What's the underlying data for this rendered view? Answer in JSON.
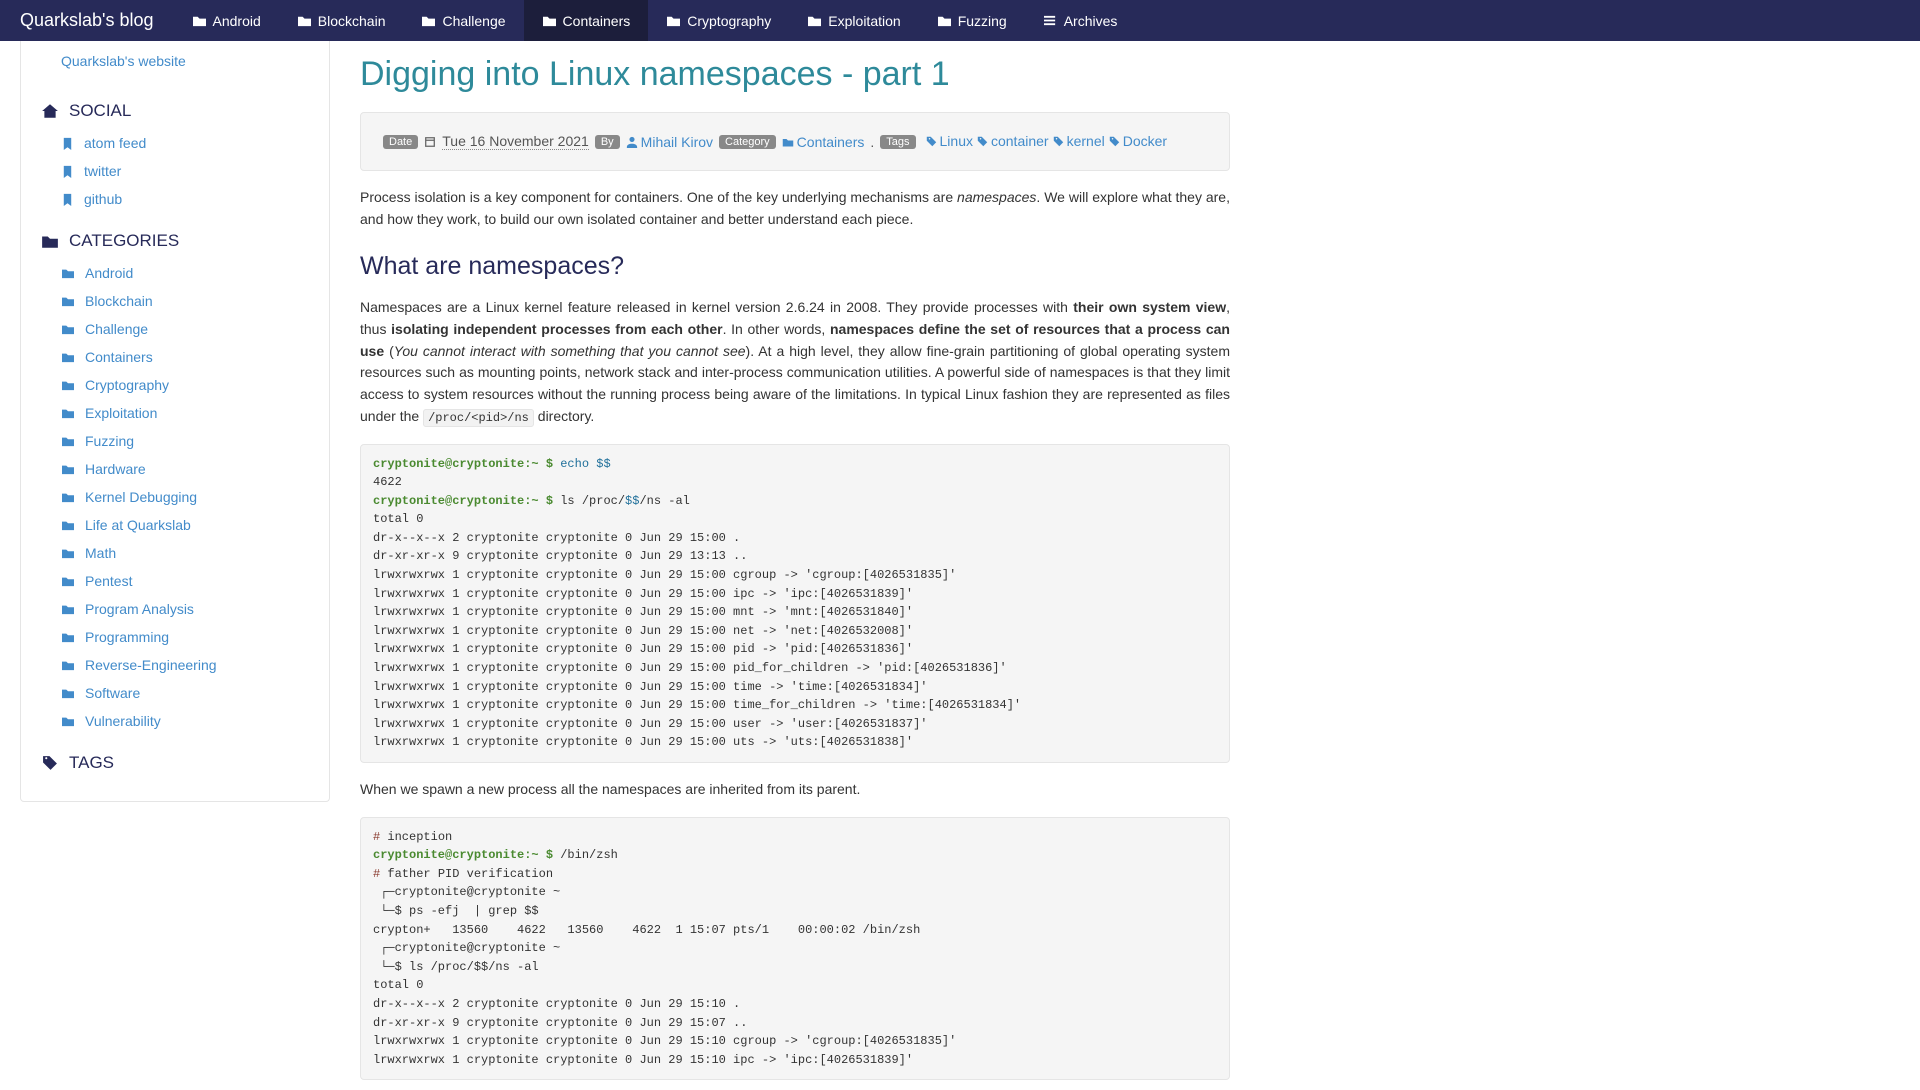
{
  "brand": "Quarkslab's blog",
  "nav": [
    {
      "label": "Android",
      "icon": "folder"
    },
    {
      "label": "Blockchain",
      "icon": "folder"
    },
    {
      "label": "Challenge",
      "icon": "folder"
    },
    {
      "label": "Containers",
      "icon": "folder",
      "active": true
    },
    {
      "label": "Cryptography",
      "icon": "folder"
    },
    {
      "label": "Exploitation",
      "icon": "folder"
    },
    {
      "label": "Fuzzing",
      "icon": "folder"
    },
    {
      "label": "Archives",
      "icon": "list"
    }
  ],
  "sidebar": {
    "site_link": "Quarkslab's website",
    "social_h": "SOCIAL",
    "social": [
      {
        "label": "atom feed",
        "icon": "bookmark"
      },
      {
        "label": "twitter",
        "icon": "bookmark"
      },
      {
        "label": "github",
        "icon": "bookmark"
      }
    ],
    "categories_h": "CATEGORIES",
    "categories": [
      "Android",
      "Blockchain",
      "Challenge",
      "Containers",
      "Cryptography",
      "Exploitation",
      "Fuzzing",
      "Hardware",
      "Kernel Debugging",
      "Life at Quarkslab",
      "Math",
      "Pentest",
      "Program Analysis",
      "Programming",
      "Reverse-Engineering",
      "Software",
      "Vulnerability"
    ],
    "tags_h": "TAGS"
  },
  "article": {
    "title": "Digging into Linux namespaces - part 1",
    "meta": {
      "date_label": "Date",
      "date": "Tue 16 November 2021",
      "by_label": "By",
      "author": "Mihail Kirov",
      "category_label": "Category",
      "category": "Containers",
      "dot": ".",
      "tags_label": "Tags",
      "tags": [
        "Linux",
        "container",
        "kernel",
        "Docker"
      ]
    },
    "p1_a": "Process isolation is a key component for containers. One of the key underlying mechanisms are ",
    "p1_em": "namespaces",
    "p1_b": ". We will explore what they are, and how they work, to build our own isolated container and better understand each piece.",
    "h_what": "What are namespaces?",
    "p2_a": "Namespaces are a Linux kernel feature released in kernel version 2.6.24 in 2008. They provide processes with ",
    "p2_s1": "their own system view",
    "p2_b": ", thus ",
    "p2_s2": "isolating independent processes from each other",
    "p2_c": ". In other words, ",
    "p2_s3": "namespaces define the set of resources that a process can use",
    "p2_d": " (",
    "p2_em": "You cannot interact with something that you cannot see",
    "p2_e": "). At a high level, they allow fine-grain partitioning of global operating system resources such as mounting points, network stack and inter-process communication utilities. A powerful side of namespaces is that they limit access to system resources without the running process being aware of the limitations. In typical Linux fashion they are represented as files under the ",
    "p2_code": "/proc/<pid>/ns",
    "p2_f": " directory.",
    "code1": {
      "prompt": "cryptonite@cryptonite:~ $",
      "echo": "echo",
      "dd": "$$",
      "pid": "4622",
      "ls": "ls /proc/",
      "ls_tail": "/ns -al",
      "body": "total 0\ndr-x--x--x 2 cryptonite cryptonite 0 Jun 29 15:00 .\ndr-xr-xr-x 9 cryptonite cryptonite 0 Jun 29 13:13 ..\nlrwxrwxrwx 1 cryptonite cryptonite 0 Jun 29 15:00 cgroup -> 'cgroup:[4026531835]'\nlrwxrwxrwx 1 cryptonite cryptonite 0 Jun 29 15:00 ipc -> 'ipc:[4026531839]'\nlrwxrwxrwx 1 cryptonite cryptonite 0 Jun 29 15:00 mnt -> 'mnt:[4026531840]'\nlrwxrwxrwx 1 cryptonite cryptonite 0 Jun 29 15:00 net -> 'net:[4026532008]'\nlrwxrwxrwx 1 cryptonite cryptonite 0 Jun 29 15:00 pid -> 'pid:[4026531836]'\nlrwxrwxrwx 1 cryptonite cryptonite 0 Jun 29 15:00 pid_for_children -> 'pid:[4026531836]'\nlrwxrwxrwx 1 cryptonite cryptonite 0 Jun 29 15:00 time -> 'time:[4026531834]'\nlrwxrwxrwx 1 cryptonite cryptonite 0 Jun 29 15:00 time_for_children -> 'time:[4026531834]'\nlrwxrwxrwx 1 cryptonite cryptonite 0 Jun 29 15:00 user -> 'user:[4026531837]'\nlrwxrwxrwx 1 cryptonite cryptonite 0 Jun 29 15:00 uts -> 'uts:[4026531838]'"
    },
    "p3": "When we spawn a new process all the namespaces are inherited from its parent.",
    "code2": {
      "c1": "# ",
      "c1t": "inception",
      "prompt": "cryptonite@cryptonite:~ $",
      "cmd1": "/bin/zsh",
      "c2": "# ",
      "c2t": "father PID verification",
      "body": " ┌─cryptonite@cryptonite ~\n └─$ ps -efj  | grep $$\ncrypton+   13560    4622   13560    4622  1 15:07 pts/1    00:00:02 /bin/zsh\n ┌─cryptonite@cryptonite ~\n └─$ ls /proc/$$/ns -al\ntotal 0\ndr-x--x--x 2 cryptonite cryptonite 0 Jun 29 15:10 .\ndr-xr-xr-x 9 cryptonite cryptonite 0 Jun 29 15:07 ..\nlrwxrwxrwx 1 cryptonite cryptonite 0 Jun 29 15:10 cgroup -> 'cgroup:[4026531835]'\nlrwxrwxrwx 1 cryptonite cryptonite 0 Jun 29 15:10 ipc -> 'ipc:[4026531839]'"
    }
  }
}
